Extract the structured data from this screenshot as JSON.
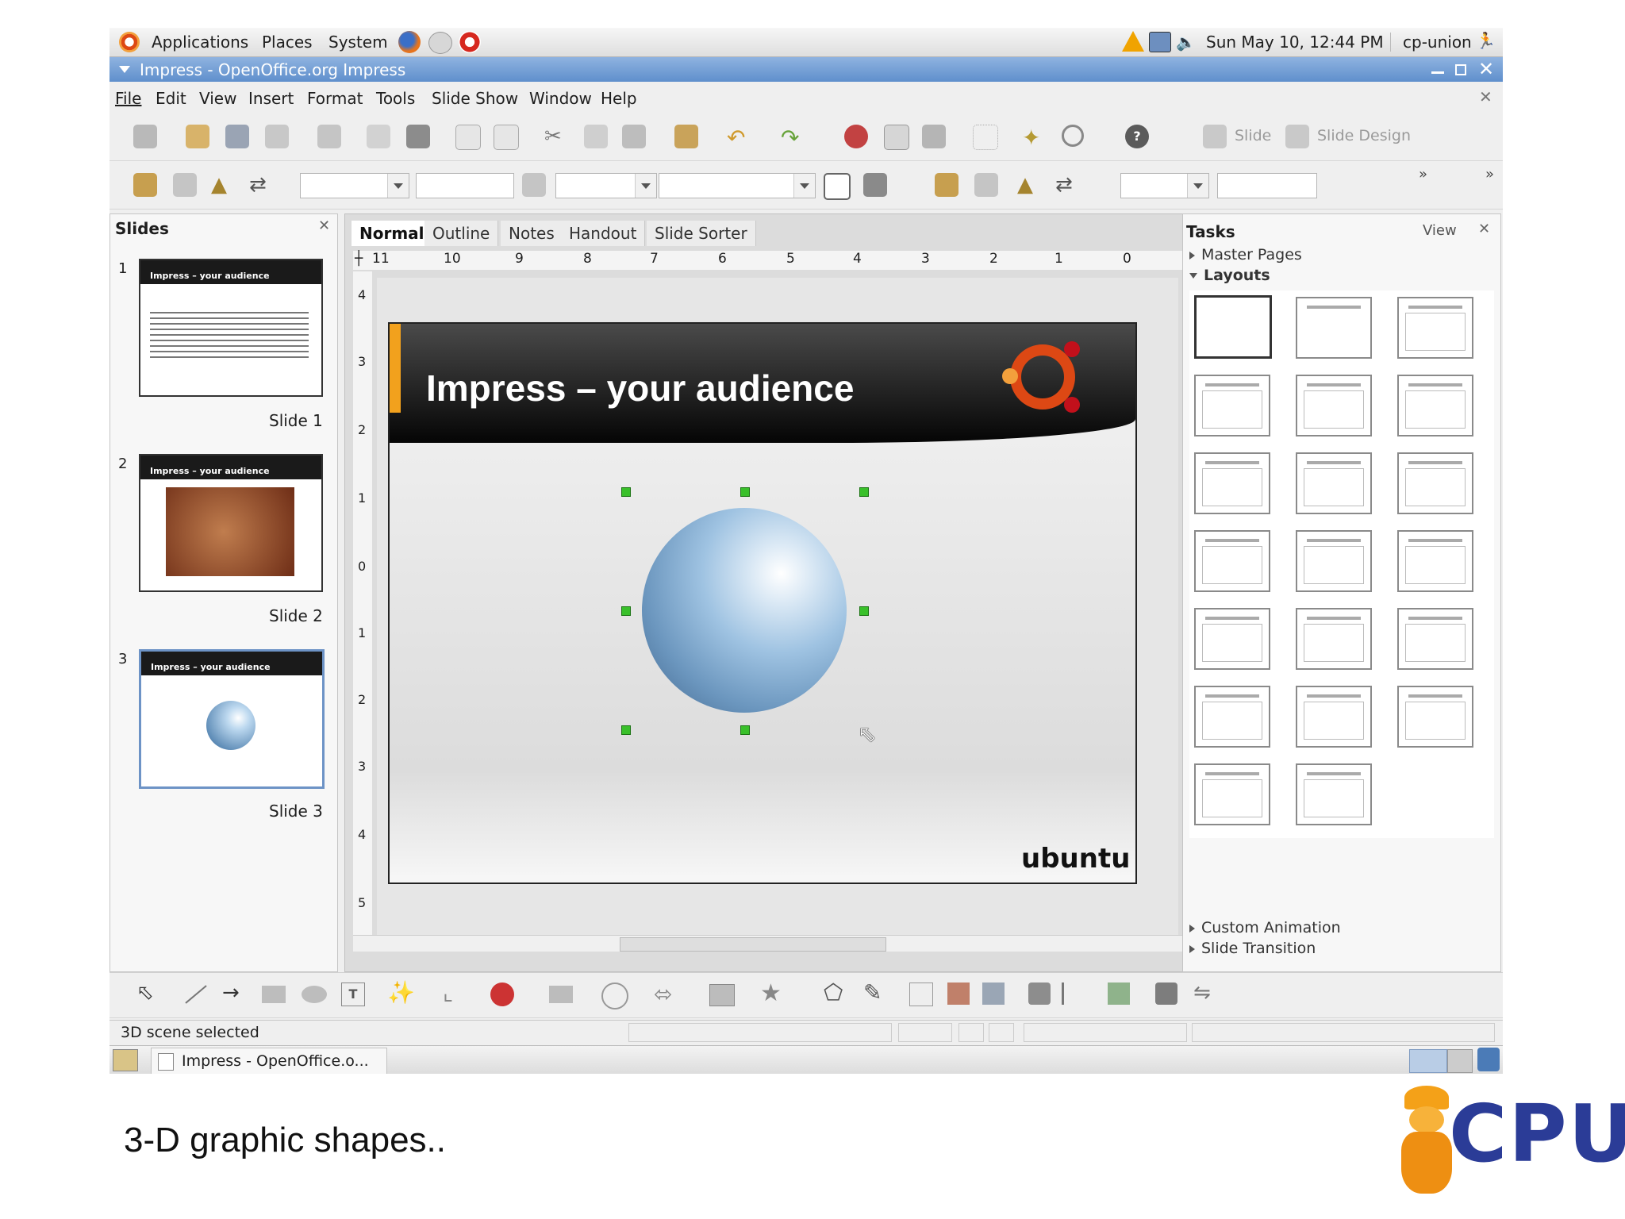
{
  "top_panel": {
    "menus": [
      "Applications",
      "Places",
      "System"
    ],
    "clock": "Sun May 10, 12:44 PM",
    "user": "cp-union"
  },
  "window": {
    "title": "Impress - OpenOffice.org Impress"
  },
  "menubar": [
    "File",
    "Edit",
    "View",
    "Insert",
    "Format",
    "Tools",
    "Slide Show",
    "Window",
    "Help"
  ],
  "toolbar": {
    "slide_label": "Slide",
    "slide_design_label": "Slide Design"
  },
  "slides_pane": {
    "title": "Slides",
    "slides": [
      {
        "number": "1",
        "label": "Slide 1",
        "header": "Impress – your audience"
      },
      {
        "number": "2",
        "label": "Slide 2",
        "header": "Impress – your audience"
      },
      {
        "number": "3",
        "label": "Slide 3",
        "header": "Impress – your audience"
      }
    ]
  },
  "view_tabs": [
    "Normal",
    "Outline",
    "Notes",
    "Handout",
    "Slide Sorter"
  ],
  "ruler": {
    "horizontal": [
      "11",
      "10",
      "9",
      "8",
      "7",
      "6",
      "5",
      "4",
      "3",
      "2",
      "1",
      "0"
    ],
    "vertical": [
      "4",
      "3",
      "2",
      "1",
      "0",
      "1",
      "2",
      "3",
      "4",
      "5"
    ]
  },
  "slide": {
    "title": "Impress – your audience",
    "footer_logo": "ubuntu"
  },
  "tasks": {
    "title": "Tasks",
    "view_label": "View",
    "sections": [
      "Master Pages",
      "Layouts"
    ],
    "bottom_sections": [
      "Custom Animation",
      "Slide Transition"
    ]
  },
  "status": {
    "text": "3D scene selected"
  },
  "taskbar": {
    "window_button": "Impress - OpenOffice.o..."
  },
  "caption": "3-D graphic shapes..",
  "brand": {
    "logo_text": "CPU"
  },
  "colors": {
    "titlebar": "#6f9bd4",
    "selection_handle": "#39c02a",
    "ubuntu_orange": "#dd4814"
  }
}
